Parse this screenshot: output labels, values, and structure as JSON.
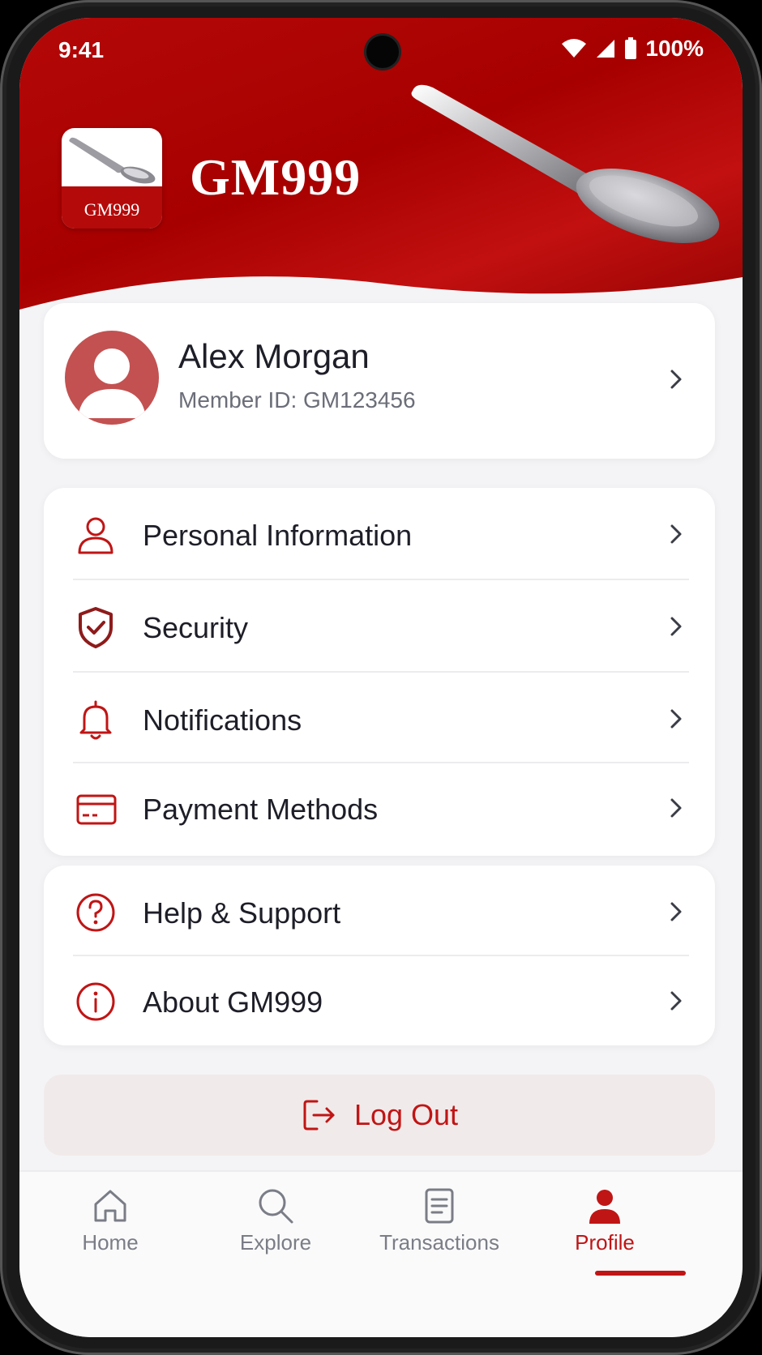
{
  "status_bar": {
    "time": "9:41",
    "battery": "100%"
  },
  "header": {
    "brand": "GM999",
    "logo_text": "GM999"
  },
  "profile": {
    "name": "Alex Morgan",
    "member_id": "Member ID: GM123456"
  },
  "menu_group_1": [
    {
      "label": "Personal Information",
      "icon": "person-icon"
    },
    {
      "label": "Security",
      "icon": "shield-check-icon"
    },
    {
      "label": "Notifications",
      "icon": "bell-icon"
    },
    {
      "label": "Payment Methods",
      "icon": "credit-card-icon"
    }
  ],
  "menu_group_2": [
    {
      "label": "Help & Support",
      "icon": "help-circle-icon"
    },
    {
      "label": "About GM999",
      "icon": "info-circle-icon"
    }
  ],
  "logout": {
    "label": "Log Out"
  },
  "bottom_nav": [
    {
      "label": "Home",
      "icon": "home-icon",
      "active": false
    },
    {
      "label": "Explore",
      "icon": "search-icon",
      "active": false
    },
    {
      "label": "Transactions",
      "icon": "document-icon",
      "active": false
    },
    {
      "label": "Profile",
      "icon": "user-icon",
      "active": true
    }
  ],
  "colors": {
    "brand_red": "#b50a0a",
    "accent_red": "#c01515",
    "text_dark": "#1e1e28",
    "text_muted": "#6b6e78"
  }
}
